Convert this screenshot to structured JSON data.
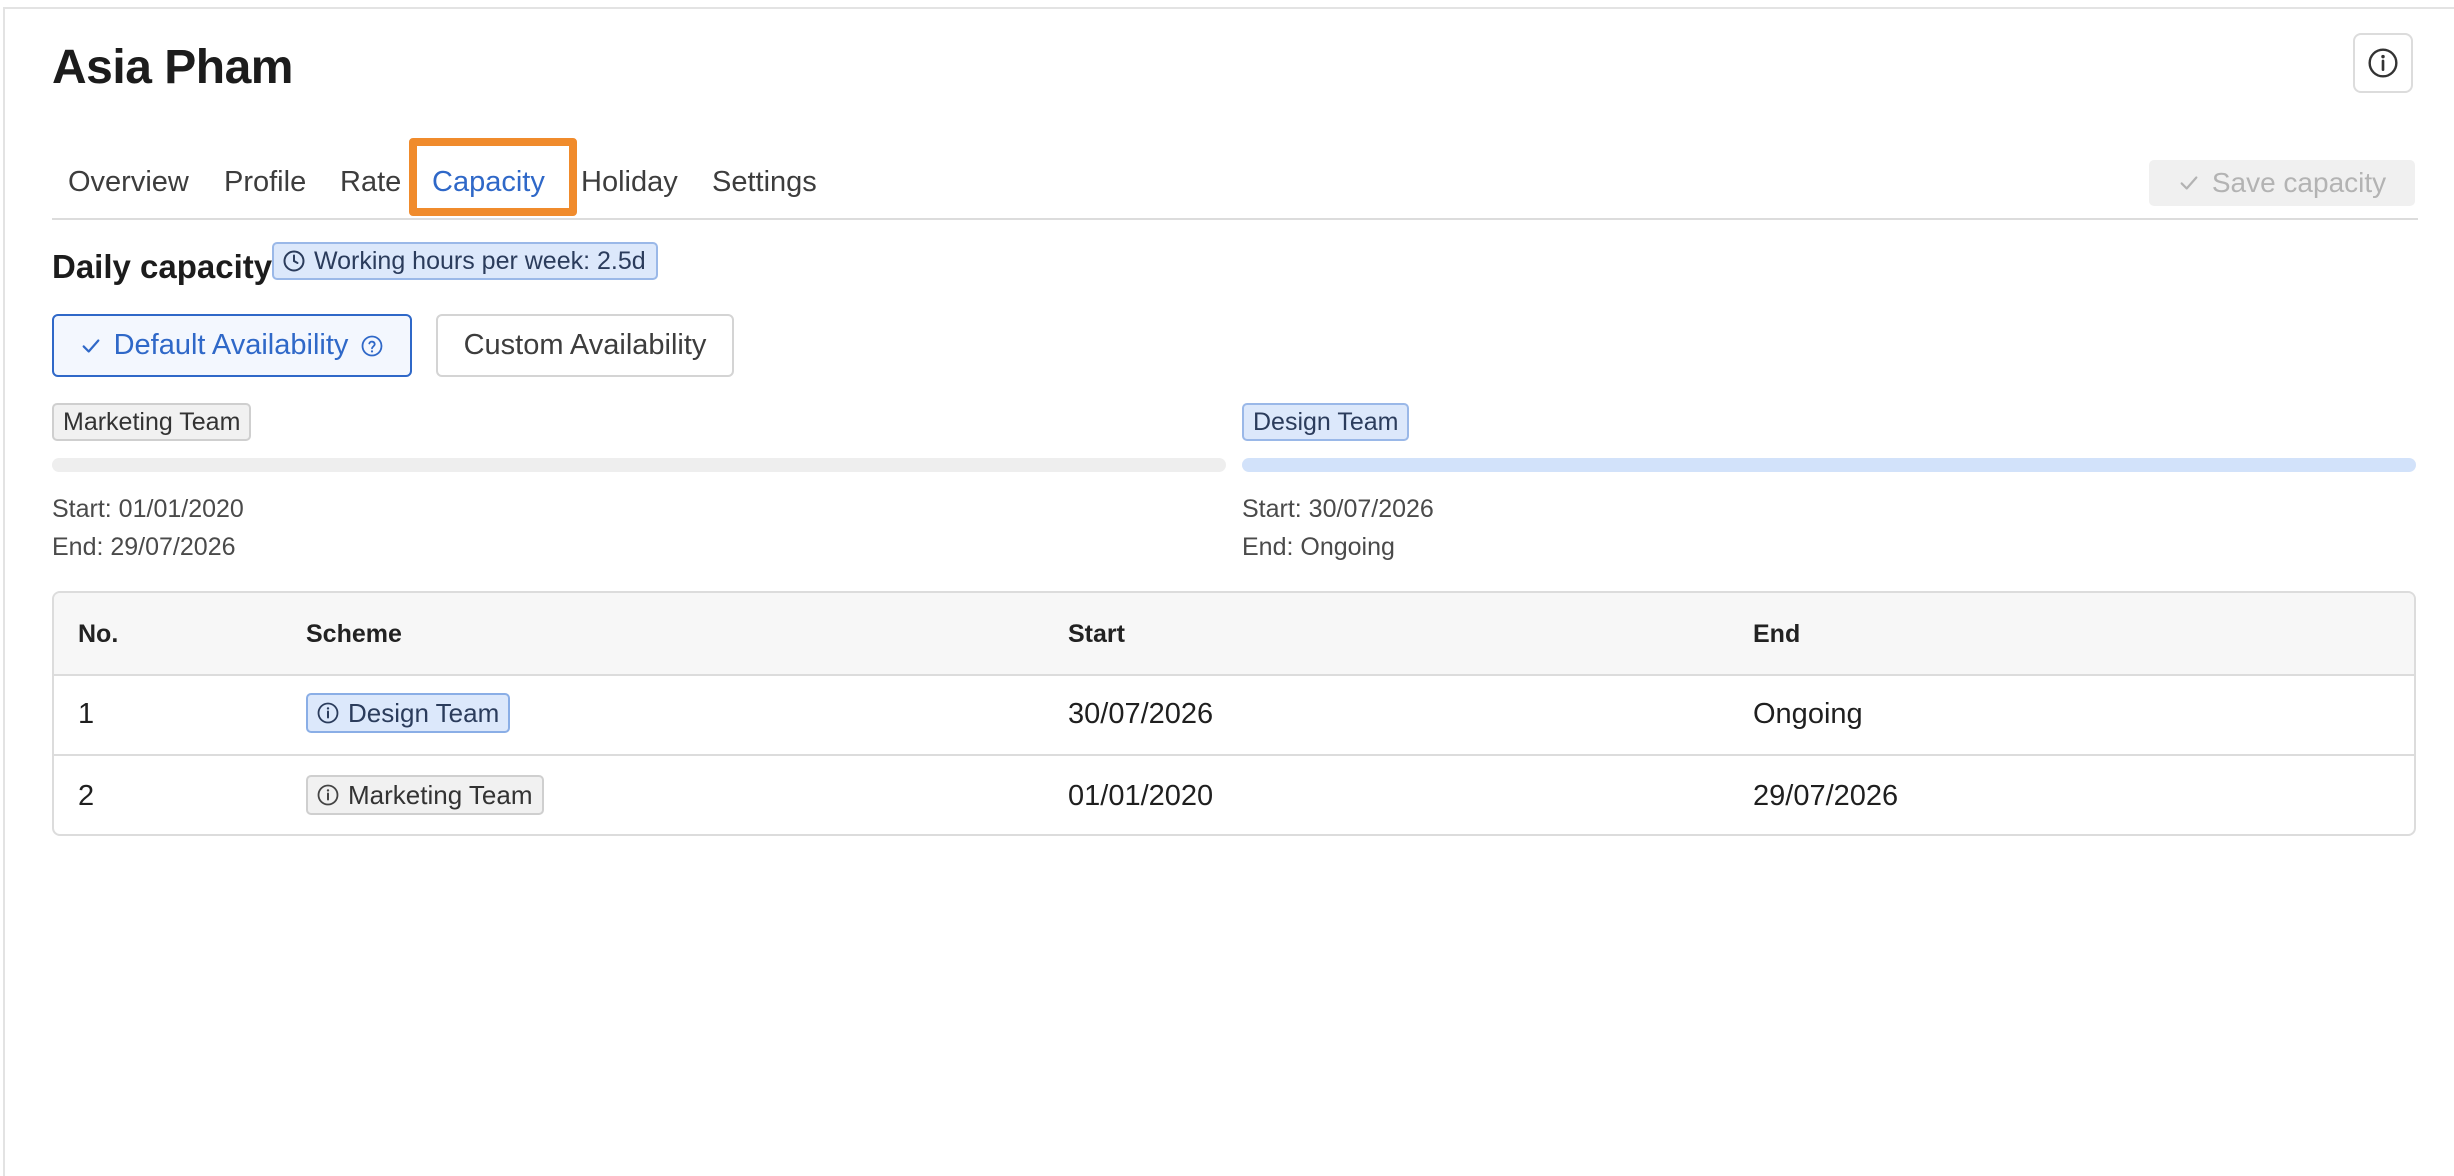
{
  "header": {
    "title": "Asia Pham",
    "info_icon": "info-circle-icon"
  },
  "tabs": [
    {
      "label": "Overview"
    },
    {
      "label": "Profile"
    },
    {
      "label": "Rate"
    },
    {
      "label": "Capacity",
      "active": true
    },
    {
      "label": "Holiday"
    },
    {
      "label": "Settings"
    }
  ],
  "toolbar": {
    "save_label": "Save capacity",
    "save_icon": "check-icon",
    "save_enabled": false
  },
  "capacity": {
    "section_title": "Daily capacity",
    "hours_badge": "Working hours per week: 2.5d",
    "hours_icon": "clock-icon",
    "default_availability_label": "Default Availability",
    "custom_availability_label": "Custom Availability",
    "selected_availability": "Default Availability"
  },
  "timeline": [
    {
      "name": "Marketing Team",
      "start_text": "Start: 01/01/2020",
      "end_text": "End: 29/07/2026",
      "current": false
    },
    {
      "name": "Design Team",
      "start_text": "Start: 30/07/2026",
      "end_text": "End: Ongoing",
      "current": true
    }
  ],
  "table": {
    "columns": [
      "No.",
      "Scheme",
      "Start",
      "End"
    ],
    "rows": [
      {
        "no": "1",
        "scheme": "Design Team",
        "start": "30/07/2026",
        "end": "Ongoing",
        "current": true
      },
      {
        "no": "2",
        "scheme": "Marketing Team",
        "start": "01/01/2020",
        "end": "29/07/2026",
        "current": false
      }
    ]
  },
  "colors": {
    "accent": "#2f68c8",
    "highlight": "#f08b2c",
    "badge_blue_bg": "#dce8fb"
  }
}
